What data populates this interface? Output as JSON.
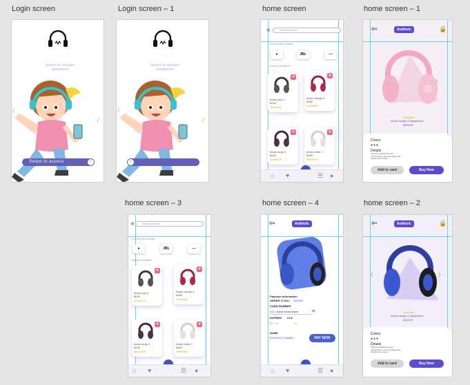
{
  "labels": {
    "login": "Login screen",
    "login1": "Login screen – 1",
    "home": "home screen",
    "home1": "home screen – 1",
    "home3": "home screen – 3",
    "home4": "home screen – 4",
    "home2": "home screen – 2"
  },
  "login": {
    "tagline": "Search for wonders headphone",
    "swipe_label": "Swipe to access"
  },
  "home": {
    "search_placeholder": "search product",
    "choose_brand": "Choose your brand",
    "brands": [
      "b",
      "JBL",
      "~"
    ],
    "product_label": "Product of Beats",
    "products": [
      {
        "name": "beats solo 3",
        "price": "$249"
      },
      {
        "name": "beats charge 4",
        "price": "$289"
      },
      {
        "name": "beats array 3",
        "price": "$249"
      },
      {
        "name": "beats white 2",
        "price": "$299"
      }
    ]
  },
  "detail": {
    "brand_chip": "Audiozic",
    "product_name": "beats charge 4 headphone",
    "price": "$409.99",
    "colors_label": "Colors",
    "details_label": "Details",
    "details_text": "Choose headphone with microphone noise canceling and quality bass sound",
    "add_to_cart": "Add to card",
    "buy_now": "Buy Now"
  },
  "payment": {
    "title": "Payment Information",
    "order_total_label": "ORDER TOTAL:",
    "order_total_value": "$16999",
    "card_number_label": "CARD NUMBER",
    "card_number_value": "5327 ●●●● ●●●● ●●●●",
    "expires_label": "EXPIRES",
    "cvv_label": "CCV",
    "expires_value": "05 / 19",
    "cvv_value": "12",
    "name_label": "NAME",
    "name_value": "RODRIGO SAMBO",
    "pay_now": "PAY NOW"
  },
  "colors": {
    "accent": "#5b4ccf",
    "guide": "#3fd2dc",
    "fab": "#3d57b6",
    "heart": "#f06a83",
    "swipe_bar": "#6060b8"
  }
}
